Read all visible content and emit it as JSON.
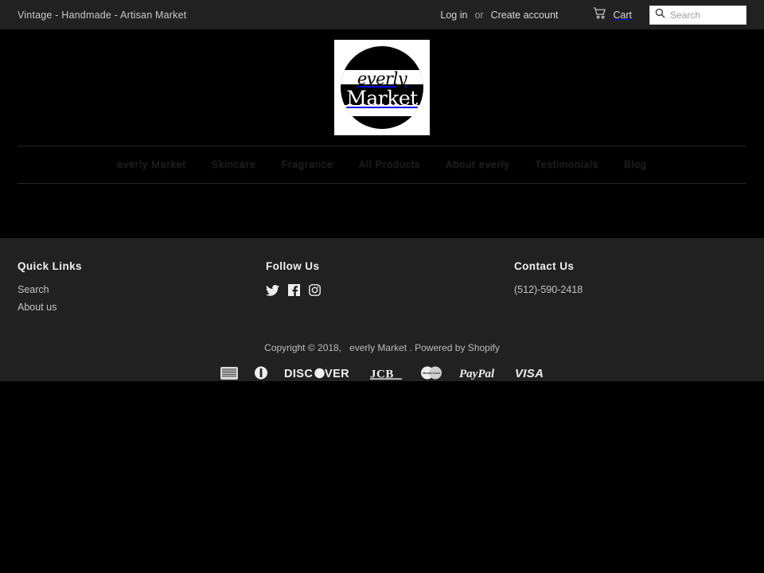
{
  "topbar": {
    "tagline": "Vintage - Handmade - Artisan Market",
    "login_label": "Log in",
    "or_label": "or",
    "create_account_label": "Create account",
    "cart_label": "Cart",
    "cart_icon": "shopping-cart-icon",
    "search_icon": "search-icon",
    "search_placeholder": "Search",
    "search_value": "",
    "background_color": "#212121"
  },
  "logo": {
    "line1": "everly",
    "line2": "Market",
    "tile_color": "#ffffff",
    "circle_color": "#000000"
  },
  "nav": {
    "items": [
      {
        "label": "everly Market"
      },
      {
        "label": "Skincare"
      },
      {
        "label": "Fragrance"
      },
      {
        "label": "All Products"
      },
      {
        "label": "About everly"
      },
      {
        "label": "Testimonials"
      },
      {
        "label": "Blog"
      }
    ],
    "divider_color": "#1d2a26"
  },
  "footer": {
    "background_color": "#212121",
    "quick_links": {
      "title": "Quick Links",
      "items": [
        {
          "label": "Search"
        },
        {
          "label": "About us"
        }
      ]
    },
    "follow_us": {
      "title": "Follow Us",
      "socials": [
        {
          "icon": "twitter-icon",
          "name": "Twitter"
        },
        {
          "icon": "facebook-icon",
          "name": "Facebook"
        },
        {
          "icon": "instagram-icon",
          "name": "Instagram"
        }
      ]
    },
    "contact_us": {
      "title": "Contact Us",
      "phone": "(512)-590-2418"
    },
    "copyright": {
      "prefix": "Copyright © 2018,",
      "store": "everly Market",
      "suffix": ". Powered by Shopify"
    },
    "payments": [
      {
        "name": "American Express",
        "icon": "amex-icon"
      },
      {
        "name": "Diners Club",
        "icon": "diners-club-icon"
      },
      {
        "name": "Discover",
        "icon": "discover-icon",
        "text": "DISC VER"
      },
      {
        "name": "JCB",
        "icon": "jcb-icon",
        "text": "JCB"
      },
      {
        "name": "Mastercard",
        "icon": "mastercard-icon",
        "text": "MasterCard"
      },
      {
        "name": "PayPal",
        "icon": "paypal-icon",
        "text": "PayPal"
      },
      {
        "name": "Visa",
        "icon": "visa-icon",
        "text": "VISA"
      }
    ]
  }
}
